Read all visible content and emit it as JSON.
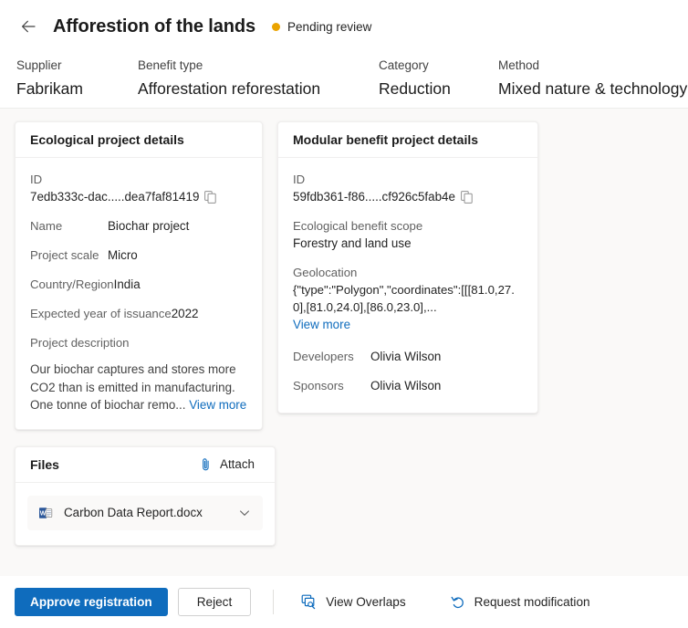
{
  "header": {
    "back_icon": "arrow-left-icon",
    "title": "Afforestion of the lands",
    "status": {
      "label": "Pending review",
      "dot_color": "#eaa300"
    },
    "meta": [
      {
        "label": "Supplier",
        "value": "Fabrikam"
      },
      {
        "label": "Benefit type",
        "value": "Afforestation reforestation"
      },
      {
        "label": "Category",
        "value": "Reduction"
      },
      {
        "label": "Method",
        "value": "Mixed nature & technology"
      }
    ]
  },
  "ecological_card": {
    "title": "Ecological project details",
    "id": {
      "label": "ID",
      "value": "7edb333c-dac.....dea7faf81419",
      "copy_icon": "copy-icon"
    },
    "name": {
      "label": "Name",
      "value": "Biochar project"
    },
    "project_scale": {
      "label": "Project scale",
      "value": "Micro"
    },
    "country": {
      "label": "Country/Region",
      "value": "India"
    },
    "expected_year": {
      "label": "Expected year of issuance",
      "value": "2022"
    },
    "description": {
      "label": "Project description",
      "value": "Our biochar captures and stores more CO2 than is emitted in manufacturing. One tonne of biochar remo...",
      "view_more": "View more"
    }
  },
  "modular_card": {
    "title": "Modular benefit project details",
    "id": {
      "label": "ID",
      "value": "59fdb361-f86.....cf926c5fab4e",
      "copy_icon": "copy-icon"
    },
    "scope": {
      "label": "Ecological benefit scope",
      "value": "Forestry and land use"
    },
    "geolocation": {
      "label": "Geolocation",
      "value": "{\"type\":\"Polygon\",\"coordinates\":[[[81.0,27.0],[81.0,24.0],[86.0,23.0],...",
      "view_more": "View more"
    },
    "developers": {
      "label": "Developers",
      "value": "Olivia Wilson"
    },
    "sponsors": {
      "label": "Sponsors",
      "value": "Olivia Wilson"
    }
  },
  "files_card": {
    "title": "Files",
    "attach_label": "Attach",
    "attach_icon": "paperclip-icon",
    "files": [
      {
        "name": "Carbon Data Report.docx",
        "icon": "word-document-icon",
        "chevron": "chevron-down-icon"
      }
    ]
  },
  "footer": {
    "approve_label": "Approve registration",
    "reject_label": "Reject",
    "view_overlaps": {
      "label": "View Overlaps",
      "icon": "overlap-search-icon"
    },
    "request_modification": {
      "label": "Request modification",
      "icon": "undo-arrow-icon"
    }
  },
  "colors": {
    "accent": "#0f6cbd",
    "link": "#0f6cbd",
    "status_pending": "#eaa300",
    "page_bg": "#faf9f8",
    "card_bg": "#ffffff"
  }
}
